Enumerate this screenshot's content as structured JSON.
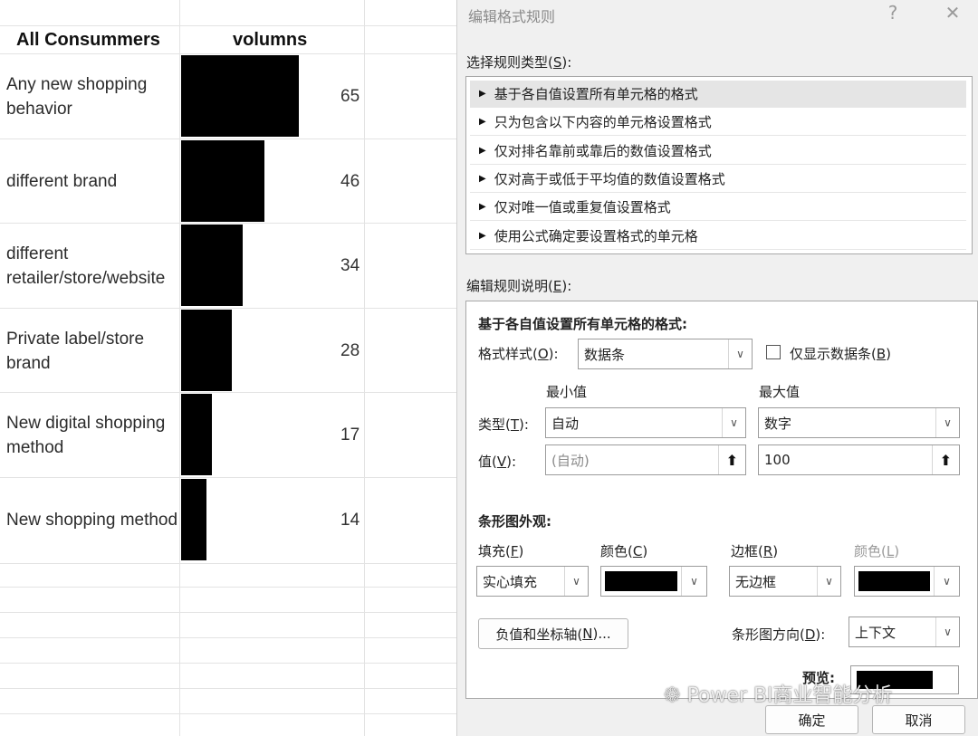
{
  "sheet": {
    "headers": {
      "category": "All Consummers",
      "value": "volumns"
    },
    "rows": [
      {
        "label": "Any new shopping behavior",
        "value": "65",
        "bar": 65
      },
      {
        "label": "different brand",
        "value": "46",
        "bar": 46
      },
      {
        "label": "different retailer/store/website",
        "value": "34",
        "bar": 34
      },
      {
        "label": "Private label/store brand",
        "value": "28",
        "bar": 28
      },
      {
        "label": "New digital shopping method",
        "value": "17",
        "bar": 17
      },
      {
        "label": "New shopping method",
        "value": "14",
        "bar": 14
      }
    ],
    "bar_color": "#000000"
  },
  "dialog": {
    "title": "编辑格式规则",
    "help": "?",
    "close": "✕",
    "select_type_label": "选择规则类型(",
    "select_type_key": "S",
    "select_type_suffix": "):",
    "rule_types": [
      "基于各自值设置所有单元格的格式",
      "只为包含以下内容的单元格设置格式",
      "仅对排名靠前或靠后的数值设置格式",
      "仅对高于或低于平均值的数值设置格式",
      "仅对唯一值或重复值设置格式",
      "使用公式确定要设置格式的单元格"
    ],
    "edit_desc_label": "编辑规则说明(",
    "edit_desc_key": "E",
    "edit_desc_suffix": "):",
    "section_title": "基于各自值设置所有单元格的格式:",
    "format_style_label": "格式样式(",
    "format_style_key": "O",
    "format_style_suffix": "):",
    "format_style_value": "数据条",
    "show_bar_only_label": "仅显示数据条(",
    "show_bar_only_key": "B",
    "show_bar_only_suffix": ")",
    "min_header": "最小值",
    "max_header": "最大值",
    "type_label": "类型(",
    "type_key": "T",
    "type_suffix": "):",
    "min_type": "自动",
    "max_type": "数字",
    "value_label": "值(",
    "value_key": "V",
    "value_suffix": "):",
    "min_value": "(自动)",
    "max_value": "100",
    "picker_glyph": "⬆",
    "bar_appearance": "条形图外观:",
    "fill_label": "填充(",
    "fill_key": "F",
    "fill_suffix": ")",
    "color_label": "颜色(",
    "color_key": "C",
    "color_suffix": ")",
    "border_label": "边框(",
    "border_key": "R",
    "border_suffix": ")",
    "border_color_label": "颜色(",
    "border_color_key": "L",
    "border_color_suffix": ")",
    "fill_value": "实心填充",
    "border_value": "无边框",
    "negative_axis_label": "负值和坐标轴(",
    "negative_axis_key": "N",
    "negative_axis_suffix": ")...",
    "direction_label": "条形图方向(",
    "direction_key": "D",
    "direction_suffix": "):",
    "direction_value": "上下文",
    "preview_label": "预览:",
    "ok": "确定",
    "cancel": "取消",
    "chevron": "∨"
  },
  "watermark": "Power BI商业智能分析"
}
